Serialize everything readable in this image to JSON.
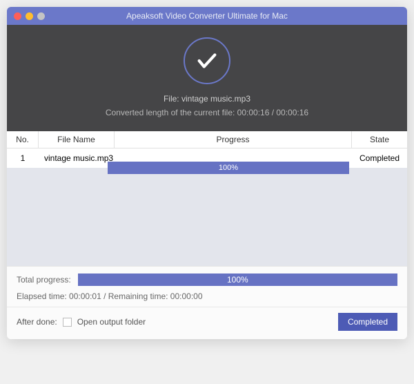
{
  "title": "Apeaksoft Video Converter Ultimate for Mac",
  "header": {
    "file_label": "File: vintage music.mp3",
    "converted_label": "Converted length of the current file: 00:00:16 / 00:00:16"
  },
  "table": {
    "headers": {
      "no": "No.",
      "name": "File Name",
      "progress": "Progress",
      "state": "State"
    },
    "rows": [
      {
        "no": "1",
        "name": "vintage music.mp3",
        "progress": "100%",
        "state": "Completed"
      }
    ]
  },
  "footer": {
    "total_label": "Total progress:",
    "total_percent": "100%",
    "time_label": "Elapsed time: 00:00:01 / Remaining time: 00:00:00",
    "after_label": "After done:",
    "open_folder_label": "Open output folder",
    "completed_btn": "Completed"
  }
}
